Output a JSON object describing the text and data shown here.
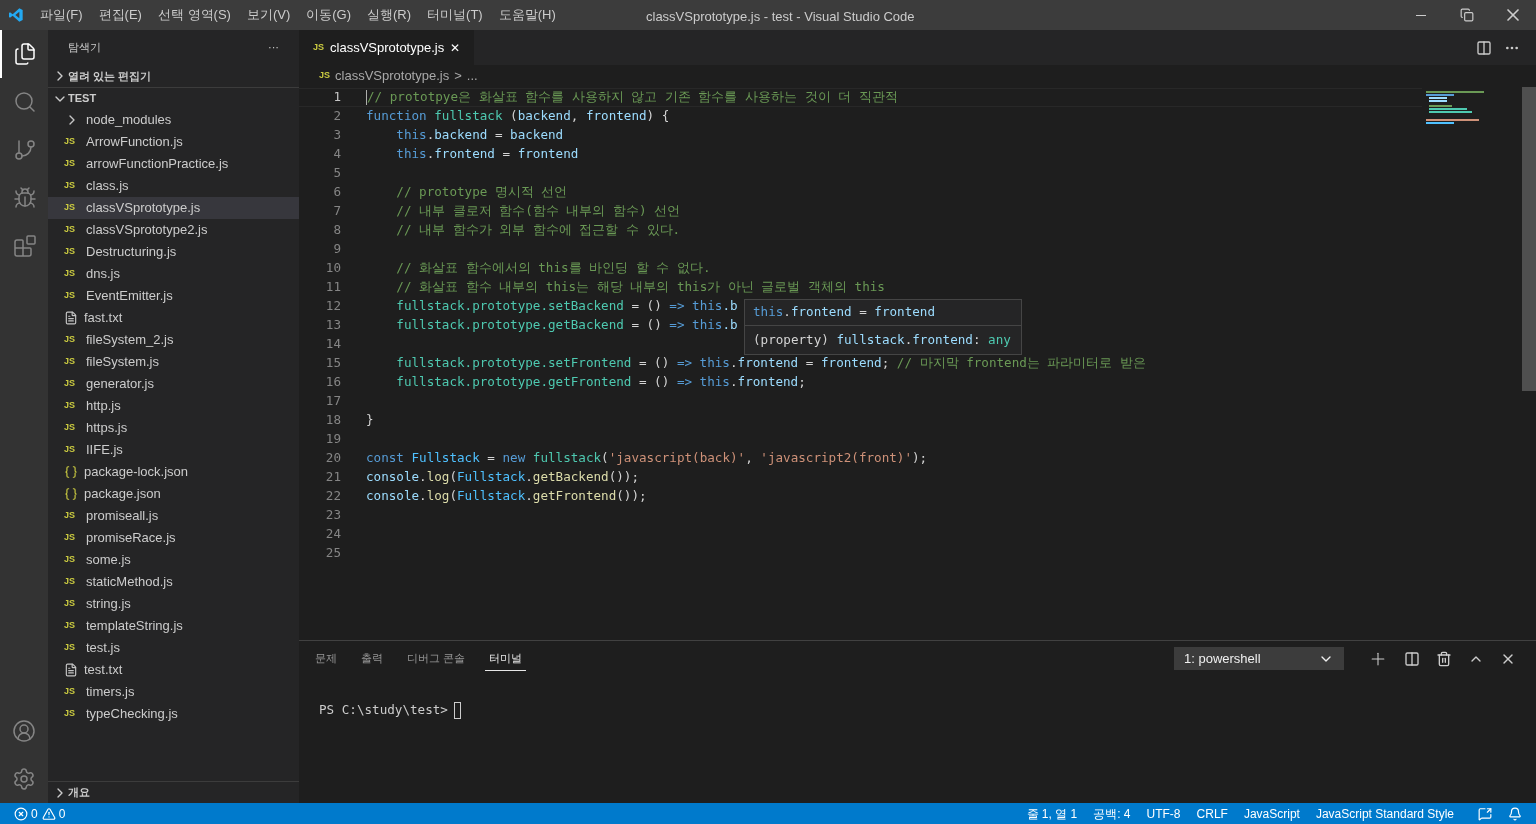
{
  "window": {
    "title": "classVSprototype.js - test - Visual Studio Code"
  },
  "menu": [
    "파일(F)",
    "편집(E)",
    "선택 영역(S)",
    "보기(V)",
    "이동(G)",
    "실행(R)",
    "터미널(T)",
    "도움말(H)"
  ],
  "activity_bar": [
    {
      "kind": "files",
      "selected": true
    },
    {
      "kind": "search",
      "selected": false
    },
    {
      "kind": "git",
      "selected": false
    },
    {
      "kind": "debug",
      "selected": false
    },
    {
      "kind": "extensions",
      "selected": false
    }
  ],
  "sidebar": {
    "title": "탐색기",
    "more": "···",
    "open_editors": "열려 있는 편집기",
    "folder": "TEST",
    "outline": "개요",
    "items": [
      {
        "kind": "folder",
        "name": "node_modules",
        "selected": false
      },
      {
        "kind": "js",
        "badge": "JS",
        "name": "ArrowFunction.js",
        "selected": false
      },
      {
        "kind": "js",
        "badge": "JS",
        "name": "arrowFunctionPractice.js",
        "selected": false
      },
      {
        "kind": "js",
        "badge": "JS",
        "name": "class.js",
        "selected": false
      },
      {
        "kind": "js",
        "badge": "JS",
        "name": "classVSprototype.js",
        "selected": true
      },
      {
        "kind": "js",
        "badge": "JS",
        "name": "classVSprototype2.js",
        "selected": false
      },
      {
        "kind": "js",
        "badge": "JS",
        "name": "Destructuring.js",
        "selected": false
      },
      {
        "kind": "js",
        "badge": "JS",
        "name": "dns.js",
        "selected": false
      },
      {
        "kind": "js",
        "badge": "JS",
        "name": "EventEmitter.js",
        "selected": false
      },
      {
        "kind": "txt",
        "name": "fast.txt",
        "selected": false
      },
      {
        "kind": "js",
        "badge": "JS",
        "name": "fileSystem_2.js",
        "selected": false
      },
      {
        "kind": "js",
        "badge": "JS",
        "name": "fileSystem.js",
        "selected": false
      },
      {
        "kind": "js",
        "badge": "JS",
        "name": "generator.js",
        "selected": false
      },
      {
        "kind": "js",
        "badge": "JS",
        "name": "http.js",
        "selected": false
      },
      {
        "kind": "js",
        "badge": "JS",
        "name": "https.js",
        "selected": false
      },
      {
        "kind": "js",
        "badge": "JS",
        "name": "IIFE.js",
        "selected": false
      },
      {
        "kind": "json",
        "name": "package-lock.json",
        "selected": false
      },
      {
        "kind": "json",
        "name": "package.json",
        "selected": false
      },
      {
        "kind": "js",
        "badge": "JS",
        "name": "promiseall.js",
        "selected": false
      },
      {
        "kind": "js",
        "badge": "JS",
        "name": "promiseRace.js",
        "selected": false
      },
      {
        "kind": "js",
        "badge": "JS",
        "name": "some.js",
        "selected": false
      },
      {
        "kind": "js",
        "badge": "JS",
        "name": "staticMethod.js",
        "selected": false
      },
      {
        "kind": "js",
        "badge": "JS",
        "name": "string.js",
        "selected": false
      },
      {
        "kind": "js",
        "badge": "JS",
        "name": "templateString.js",
        "selected": false
      },
      {
        "kind": "js",
        "badge": "JS",
        "name": "test.js",
        "selected": false
      },
      {
        "kind": "txt",
        "name": "test.txt",
        "selected": false
      },
      {
        "kind": "js",
        "badge": "JS",
        "name": "timers.js",
        "selected": false
      },
      {
        "kind": "js",
        "badge": "JS",
        "name": "typeChecking.js",
        "selected": false
      }
    ]
  },
  "tab": {
    "badge": "JS",
    "label": "classVSprototype.js",
    "close": "✕"
  },
  "breadcrumb": {
    "badge": "JS",
    "file": "classVSprototype.js",
    "rest": "...",
    "sep": ">"
  },
  "code": [
    {
      "n": "1",
      "current": true,
      "tokens": [
        {
          "kind": "comment",
          "text": "// prototpye은 화살표 함수를 사용하지 않고 기존 함수를 사용하는 것이 더 직관적"
        }
      ]
    },
    {
      "n": "2",
      "current": false,
      "tokens": [
        {
          "kind": "keyword",
          "text": "function "
        },
        {
          "kind": "type",
          "text": "fullstack"
        },
        {
          "kind": "plain",
          "text": " ("
        },
        {
          "kind": "variable",
          "text": "backend"
        },
        {
          "kind": "plain",
          "text": ", "
        },
        {
          "kind": "variable",
          "text": "frontend"
        },
        {
          "kind": "plain",
          "text": ") {"
        }
      ]
    },
    {
      "n": "3",
      "current": false,
      "tokens": [
        {
          "kind": "keyword",
          "text": "    this"
        },
        {
          "kind": "plain",
          "text": "."
        },
        {
          "kind": "variable",
          "text": "backend"
        },
        {
          "kind": "plain",
          "text": " = "
        },
        {
          "kind": "variable",
          "text": "backend"
        }
      ]
    },
    {
      "n": "4",
      "current": false,
      "tokens": [
        {
          "kind": "keyword",
          "text": "    this"
        },
        {
          "kind": "plain",
          "text": "."
        },
        {
          "kind": "variable",
          "text": "frontend"
        },
        {
          "kind": "plain",
          "text": " = "
        },
        {
          "kind": "variable",
          "text": "frontend"
        }
      ]
    },
    {
      "n": "5",
      "current": false
    },
    {
      "n": "6",
      "current": false,
      "tokens": [
        {
          "kind": "comment",
          "text": "    // prototype 명시적 선언"
        }
      ]
    },
    {
      "n": "7",
      "current": false,
      "tokens": [
        {
          "kind": "comment",
          "text": "    // 내부 클로저 함수(함수 내부의 함수) 선언"
        }
      ]
    },
    {
      "n": "8",
      "current": false,
      "tokens": [
        {
          "kind": "comment",
          "text": "    // 내부 함수가 외부 함수에 접근할 수 있다."
        }
      ]
    },
    {
      "n": "9",
      "current": false
    },
    {
      "n": "10",
      "current": false,
      "tokens": [
        {
          "kind": "comment",
          "text": "    // 화살표 함수에서의 this를 바인딩 할 수 없다."
        }
      ]
    },
    {
      "n": "11",
      "current": false,
      "tokens": [
        {
          "kind": "comment",
          "text": "    // 화살표 함수 내부의 this는 해당 내부의 this가 아닌 글로벌 객체의 this"
        }
      ]
    },
    {
      "n": "12",
      "current": false,
      "tokens": [
        {
          "kind": "type",
          "text": "    fullstack.prototype.setBackend"
        },
        {
          "kind": "plain",
          "text": " = () "
        },
        {
          "kind": "keyword",
          "text": "=> this"
        },
        {
          "kind": "variable",
          "text": ".b"
        }
      ]
    },
    {
      "n": "13",
      "current": false,
      "tokens": [
        {
          "kind": "type",
          "text": "    fullstack.prototype.getBackend"
        },
        {
          "kind": "plain",
          "text": " = () "
        },
        {
          "kind": "keyword",
          "text": "=> this"
        },
        {
          "kind": "variable",
          "text": ".b"
        }
      ]
    },
    {
      "n": "14",
      "current": false
    },
    {
      "n": "15",
      "current": false,
      "tokens": [
        {
          "kind": "type",
          "text": "    fullstack.prototype.setFrontend"
        },
        {
          "kind": "plain",
          "text": " = () "
        },
        {
          "kind": "keyword",
          "text": "=> this"
        },
        {
          "kind": "plain",
          "text": "."
        },
        {
          "kind": "variable",
          "text": "frontend"
        },
        {
          "kind": "plain",
          "text": " = "
        },
        {
          "kind": "variable",
          "text": "frontend"
        },
        {
          "kind": "plain",
          "text": "; "
        },
        {
          "kind": "comment",
          "text": "// 마지막 frontend는 파라미터로 받은"
        }
      ]
    },
    {
      "n": "16",
      "current": false,
      "tokens": [
        {
          "kind": "type",
          "text": "    fullstack.prototype.getFrontend"
        },
        {
          "kind": "plain",
          "text": " = () "
        },
        {
          "kind": "keyword",
          "text": "=> this"
        },
        {
          "kind": "plain",
          "text": "."
        },
        {
          "kind": "variable",
          "text": "frontend"
        },
        {
          "kind": "plain",
          "text": ";"
        }
      ]
    },
    {
      "n": "17",
      "current": false
    },
    {
      "n": "18",
      "current": false,
      "tokens": [
        {
          "kind": "plain",
          "text": "}"
        }
      ]
    },
    {
      "n": "19",
      "current": false
    },
    {
      "n": "20",
      "current": false,
      "tokens": [
        {
          "kind": "keyword",
          "text": "const "
        },
        {
          "kind": "constant",
          "text": "Fullstack"
        },
        {
          "kind": "plain",
          "text": " = "
        },
        {
          "kind": "keyword",
          "text": "new "
        },
        {
          "kind": "type",
          "text": "fullstack"
        },
        {
          "kind": "plain",
          "text": "("
        },
        {
          "kind": "string",
          "text": "'javascript(back)'"
        },
        {
          "kind": "plain",
          "text": ", "
        },
        {
          "kind": "string",
          "text": "'javascript2(front)'"
        },
        {
          "kind": "plain",
          "text": ");"
        }
      ]
    },
    {
      "n": "21",
      "current": false,
      "tokens": [
        {
          "kind": "variable",
          "text": "console"
        },
        {
          "kind": "plain",
          "text": "."
        },
        {
          "kind": "function",
          "text": "log"
        },
        {
          "kind": "plain",
          "text": "("
        },
        {
          "kind": "constant",
          "text": "Fullstack"
        },
        {
          "kind": "plain",
          "text": "."
        },
        {
          "kind": "function",
          "text": "getBackend"
        },
        {
          "kind": "plain",
          "text": "());"
        }
      ]
    },
    {
      "n": "22",
      "current": false,
      "tokens": [
        {
          "kind": "variable",
          "text": "console"
        },
        {
          "kind": "plain",
          "text": "."
        },
        {
          "kind": "function",
          "text": "log"
        },
        {
          "kind": "plain",
          "text": "("
        },
        {
          "kind": "constant",
          "text": "Fullstack"
        },
        {
          "kind": "plain",
          "text": "."
        },
        {
          "kind": "function",
          "text": "getFrontend"
        },
        {
          "kind": "plain",
          "text": "());"
        }
      ]
    },
    {
      "n": "23",
      "current": false
    },
    {
      "n": "24",
      "current": false
    },
    {
      "n": "25",
      "current": false
    }
  ],
  "hover": {
    "code": [
      {
        "kind": "keyword",
        "text": "this"
      },
      {
        "kind": "plain",
        "text": "."
      },
      {
        "kind": "variable",
        "text": "frontend"
      },
      {
        "kind": "plain",
        "text": " = "
      },
      {
        "kind": "variable",
        "text": "frontend"
      }
    ],
    "signature": [
      {
        "kind": "plain",
        "text": "(property) "
      },
      {
        "kind": "variable",
        "text": "fullstack"
      },
      {
        "kind": "plain",
        "text": "."
      },
      {
        "kind": "variable",
        "text": "frontend"
      },
      {
        "kind": "plain",
        "text": ": "
      },
      {
        "kind": "type",
        "text": "any"
      }
    ]
  },
  "panel": {
    "tabs": [
      {
        "label": "문제",
        "selected": false
      },
      {
        "label": "출력",
        "selected": false
      },
      {
        "label": "디버그 콘솔",
        "selected": false
      },
      {
        "label": "터미널",
        "selected": true
      }
    ],
    "terminal_select": "1: powershell",
    "prompt": "PS C:\\study\\test>"
  },
  "status_bar": {
    "errors": "0",
    "warnings": "0",
    "items": [
      "줄 1, 열 1",
      "공백: 4",
      "UTF-8",
      "CRLF",
      "JavaScript",
      "JavaScript Standard Style"
    ]
  }
}
